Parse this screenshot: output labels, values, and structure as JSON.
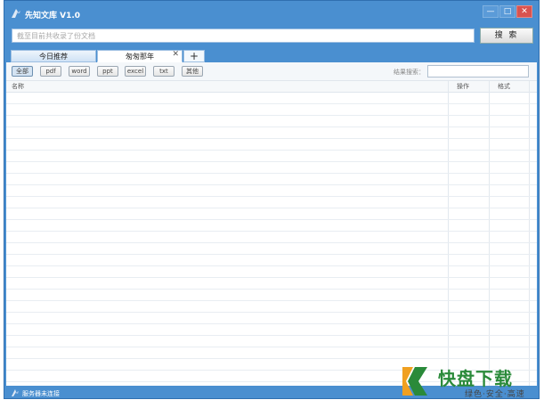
{
  "window": {
    "title": "先知文库 V1.0",
    "controls": [
      "—",
      "□",
      "✕"
    ]
  },
  "search": {
    "placeholder": "截至目前共收录了份文档",
    "button_label": "搜 索"
  },
  "tabs": [
    {
      "label": "今日推荐",
      "active": false
    },
    {
      "label": "匆匆那年",
      "active": true,
      "close": "✕"
    }
  ],
  "tab_add_label": "+",
  "filters": [
    "全部",
    "pdf",
    "word",
    "ppt",
    "excel",
    "txt",
    "其他"
  ],
  "result_search_label": "结果搜索：",
  "table": {
    "columns": [
      "名称",
      "操作",
      "格式"
    ],
    "rows": []
  },
  "status": {
    "text": "服务器未连接"
  },
  "watermark": {
    "title": "快盘下载",
    "subtitle": "绿色·安全·高速"
  },
  "colors": {
    "frame": "#4a8fd0",
    "watermark_green": "#2a8a3a",
    "watermark_orange": "#f0a020"
  }
}
